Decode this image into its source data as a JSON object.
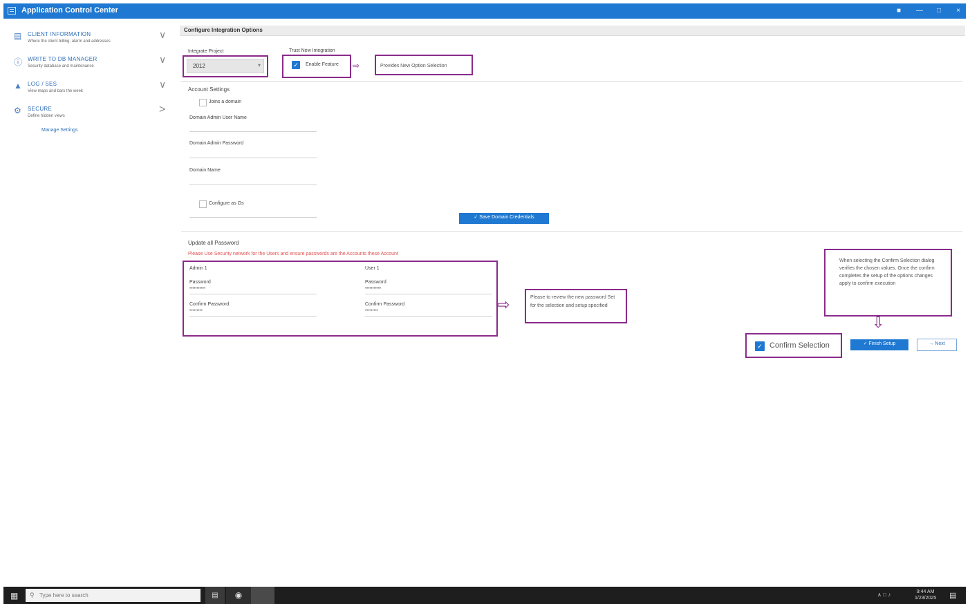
{
  "window": {
    "title": "Application Control Center",
    "controls": [
      "person-icon",
      "minimize-icon",
      "restore-icon",
      "close-icon"
    ]
  },
  "sidebar": {
    "items": [
      {
        "label": "CLIENT INFORMATION",
        "sub": "Where the client billing, alarm and addresses",
        "icon": "client-icon",
        "chevron": "∨"
      },
      {
        "label": "WRITE TO DB MANAGER",
        "sub": "Security database and maintenance",
        "icon": "info-icon",
        "chevron": "∨"
      },
      {
        "label": "LOG / SES",
        "sub": "View maps and bars the week",
        "icon": "log-icon",
        "chevron": "∨"
      },
      {
        "label": "SECURE",
        "sub": "Define hidden views",
        "icon": "secure-icon",
        "chevron": ">"
      }
    ],
    "sub_link": "Manage Settings"
  },
  "main": {
    "section_title": "Configure Integration Options",
    "integ_label": "Integrate Project",
    "integ_value": "2012",
    "trust_label": "Trust New Integration",
    "enable_label": "Enable Feature",
    "enable_note": "Provides New Option Selection",
    "account_title": "Account Settings",
    "join_domain": "Joins a domain",
    "domain_admin_user": "Domain Admin User Name",
    "domain_admin_pass": "Domain Admin Password",
    "domain_name": "Domain Name",
    "configure_os": "Configure as Os",
    "save_button": "✓ Save Domain Credentials",
    "update_title": "Update all Password",
    "warning": "Please Use Security network for the Users and ensure passwords are the Accounts these Account",
    "admin_header": "Admin 1",
    "user_header": "User 1",
    "password_label": "Password",
    "password_value": "•••••••••••",
    "confirm_label": "Confirm Password",
    "confirm_value": "•••••••••",
    "password_note": "Please to review the new password Set for the selection and setup specified",
    "confirm_note": "When selecting the Confirm Selection dialog verifies the chosen values. Once the confirm completes the setup of the options changes apply to confirm execution",
    "confirm_selection": "Confirm Selection",
    "finish_button": "✓ Finish Setup",
    "next_button": "→ Next"
  },
  "taskbar": {
    "search_placeholder": "Type here to search",
    "time": "9:44 AM",
    "date": "1/23/2025"
  }
}
